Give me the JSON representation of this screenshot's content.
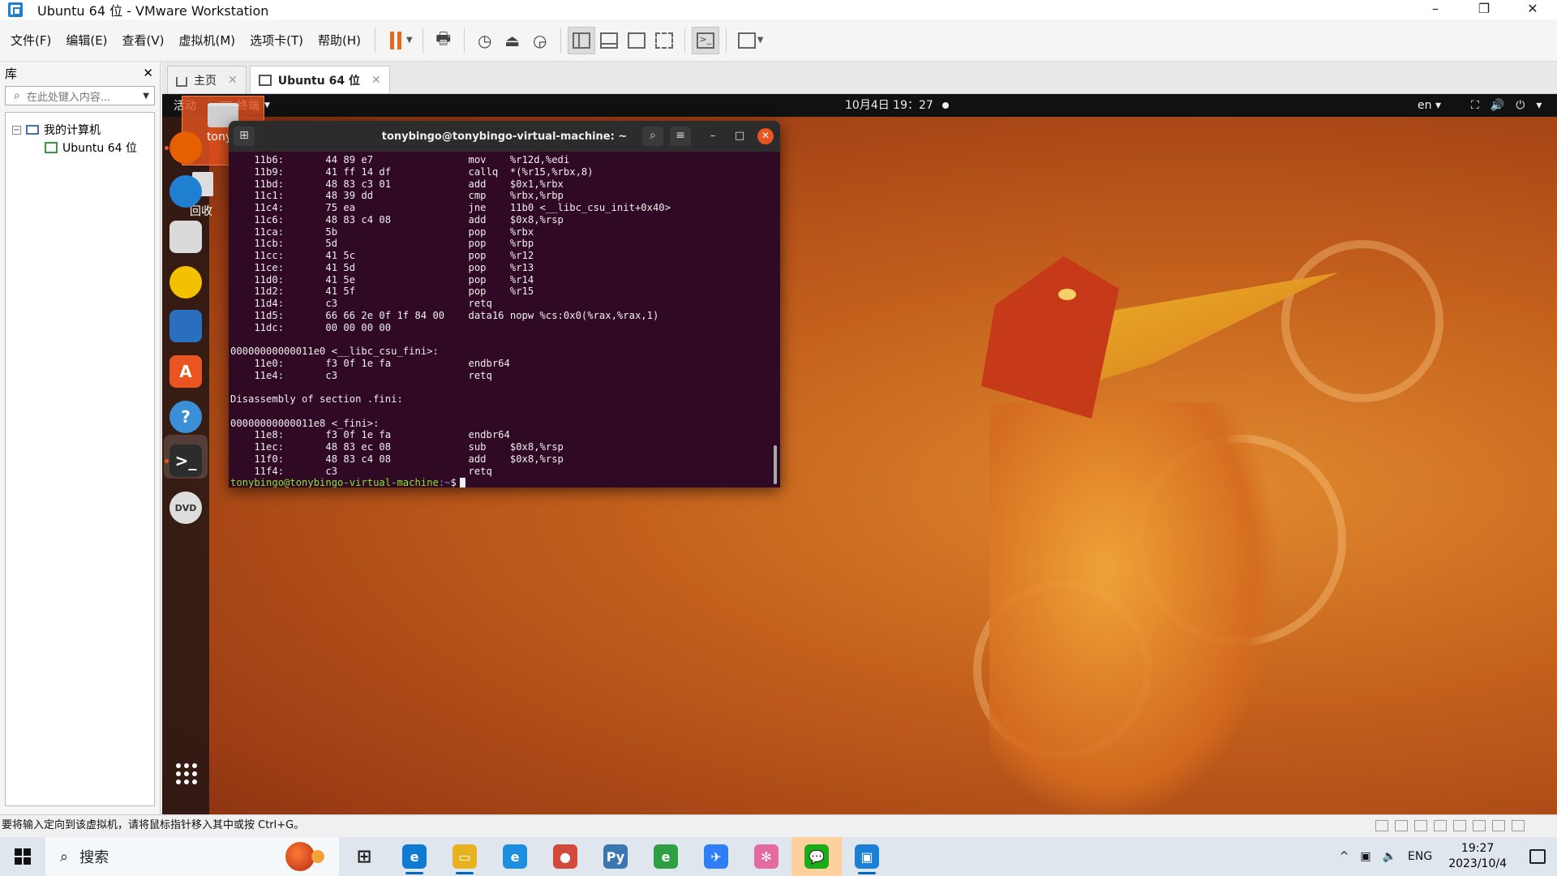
{
  "window": {
    "title": "Ubuntu 64 位 - VMware Workstation",
    "controls": [
      "–",
      "❐",
      "✕"
    ]
  },
  "menu": [
    "文件(F)",
    "编辑(E)",
    "查看(V)",
    "虚拟机(M)",
    "选项卡(T)",
    "帮助(H)"
  ],
  "library": {
    "title": "库",
    "close": "✕",
    "search_placeholder": "在此处键入内容...",
    "tree": {
      "root_label": "我的计算机",
      "toggle": "−",
      "child_label": "Ubuntu 64 位"
    }
  },
  "tabs": [
    {
      "label": "主页",
      "close": "✕"
    },
    {
      "label": "Ubuntu 64 位",
      "close": "✕"
    }
  ],
  "guest": {
    "activities": "活动",
    "app_menu": "终端",
    "clock": "10月4日 19：27",
    "lang": "en",
    "desktop_home_label": "tonyb",
    "desktop_trash_label": "回收"
  },
  "dock": [
    {
      "name": "firefox",
      "glyph": "",
      "color": "#e66000"
    },
    {
      "name": "thunderbird",
      "glyph": "",
      "color": "#1f7fd1"
    },
    {
      "name": "files",
      "glyph": "",
      "color": "#dadada"
    },
    {
      "name": "rhythmbox",
      "glyph": "",
      "color": "#f2c200"
    },
    {
      "name": "libreoffice-writer",
      "glyph": "",
      "color": "#2a6fbf"
    },
    {
      "name": "ubuntu-software",
      "glyph": "A",
      "color": "#e95420"
    },
    {
      "name": "help",
      "glyph": "?",
      "color": "#3b8fd6"
    },
    {
      "name": "terminal",
      "glyph": ">_",
      "color": "#2c2c2c"
    },
    {
      "name": "dvd",
      "glyph": "DVD",
      "color": "#dddddd"
    }
  ],
  "terminal": {
    "title": "tonybingo@tonybingo-virtual-machine: ~",
    "lines": [
      "    11b6:       44 89 e7                mov    %r12d,%edi",
      "    11b9:       41 ff 14 df             callq  *(%r15,%rbx,8)",
      "    11bd:       48 83 c3 01             add    $0x1,%rbx",
      "    11c1:       48 39 dd                cmp    %rbx,%rbp",
      "    11c4:       75 ea                   jne    11b0 <__libc_csu_init+0x40>",
      "    11c6:       48 83 c4 08             add    $0x8,%rsp",
      "    11ca:       5b                      pop    %rbx",
      "    11cb:       5d                      pop    %rbp",
      "    11cc:       41 5c                   pop    %r12",
      "    11ce:       41 5d                   pop    %r13",
      "    11d0:       41 5e                   pop    %r14",
      "    11d2:       41 5f                   pop    %r15",
      "    11d4:       c3                      retq",
      "    11d5:       66 66 2e 0f 1f 84 00    data16 nopw %cs:0x0(%rax,%rax,1)",
      "    11dc:       00 00 00 00",
      "",
      "00000000000011e0 <__libc_csu_fini>:",
      "    11e0:       f3 0f 1e fa             endbr64",
      "    11e4:       c3                      retq",
      "",
      "Disassembly of section .fini:",
      "",
      "00000000000011e8 <_fini>:",
      "    11e8:       f3 0f 1e fa             endbr64",
      "    11ec:       48 83 ec 08             sub    $0x8,%rsp",
      "    11f0:       48 83 c4 08             add    $0x8,%rsp",
      "    11f4:       c3                      retq"
    ],
    "prompt_user": "tonybingo@tonybingo-virtual-machine",
    "prompt_path": ":~",
    "prompt_symbol": "$"
  },
  "status_bar": "要将输入定向到该虚拟机，请将鼠标指针移入其中或按 Ctrl+G。",
  "taskbar": {
    "search_label": "搜索",
    "apps": [
      {
        "name": "task-view",
        "glyph": "⊞",
        "color": "#333333"
      },
      {
        "name": "edge",
        "glyph": "e",
        "color": "#0f7bd3"
      },
      {
        "name": "file-explorer",
        "glyph": "▭",
        "color": "#e8b21e"
      },
      {
        "name": "edge-dev",
        "glyph": "e",
        "color": "#1e8fe0"
      },
      {
        "name": "chrome",
        "glyph": "●",
        "color": "#d44a3a"
      },
      {
        "name": "python",
        "glyph": "Py",
        "color": "#3a76b0"
      },
      {
        "name": "sync-app",
        "glyph": "e",
        "color": "#2ea043"
      },
      {
        "name": "feishu",
        "glyph": "✈",
        "color": "#2f7ef7"
      },
      {
        "name": "pinwheel",
        "glyph": "✻",
        "color": "#e46aa0"
      },
      {
        "name": "wechat",
        "glyph": "💬",
        "color": "#1aad19"
      },
      {
        "name": "vmware",
        "glyph": "▣",
        "color": "#1c7fd6"
      }
    ],
    "tray_caret": "^",
    "ime": "ENG",
    "time": "19:27",
    "date": "2023/10/4"
  }
}
